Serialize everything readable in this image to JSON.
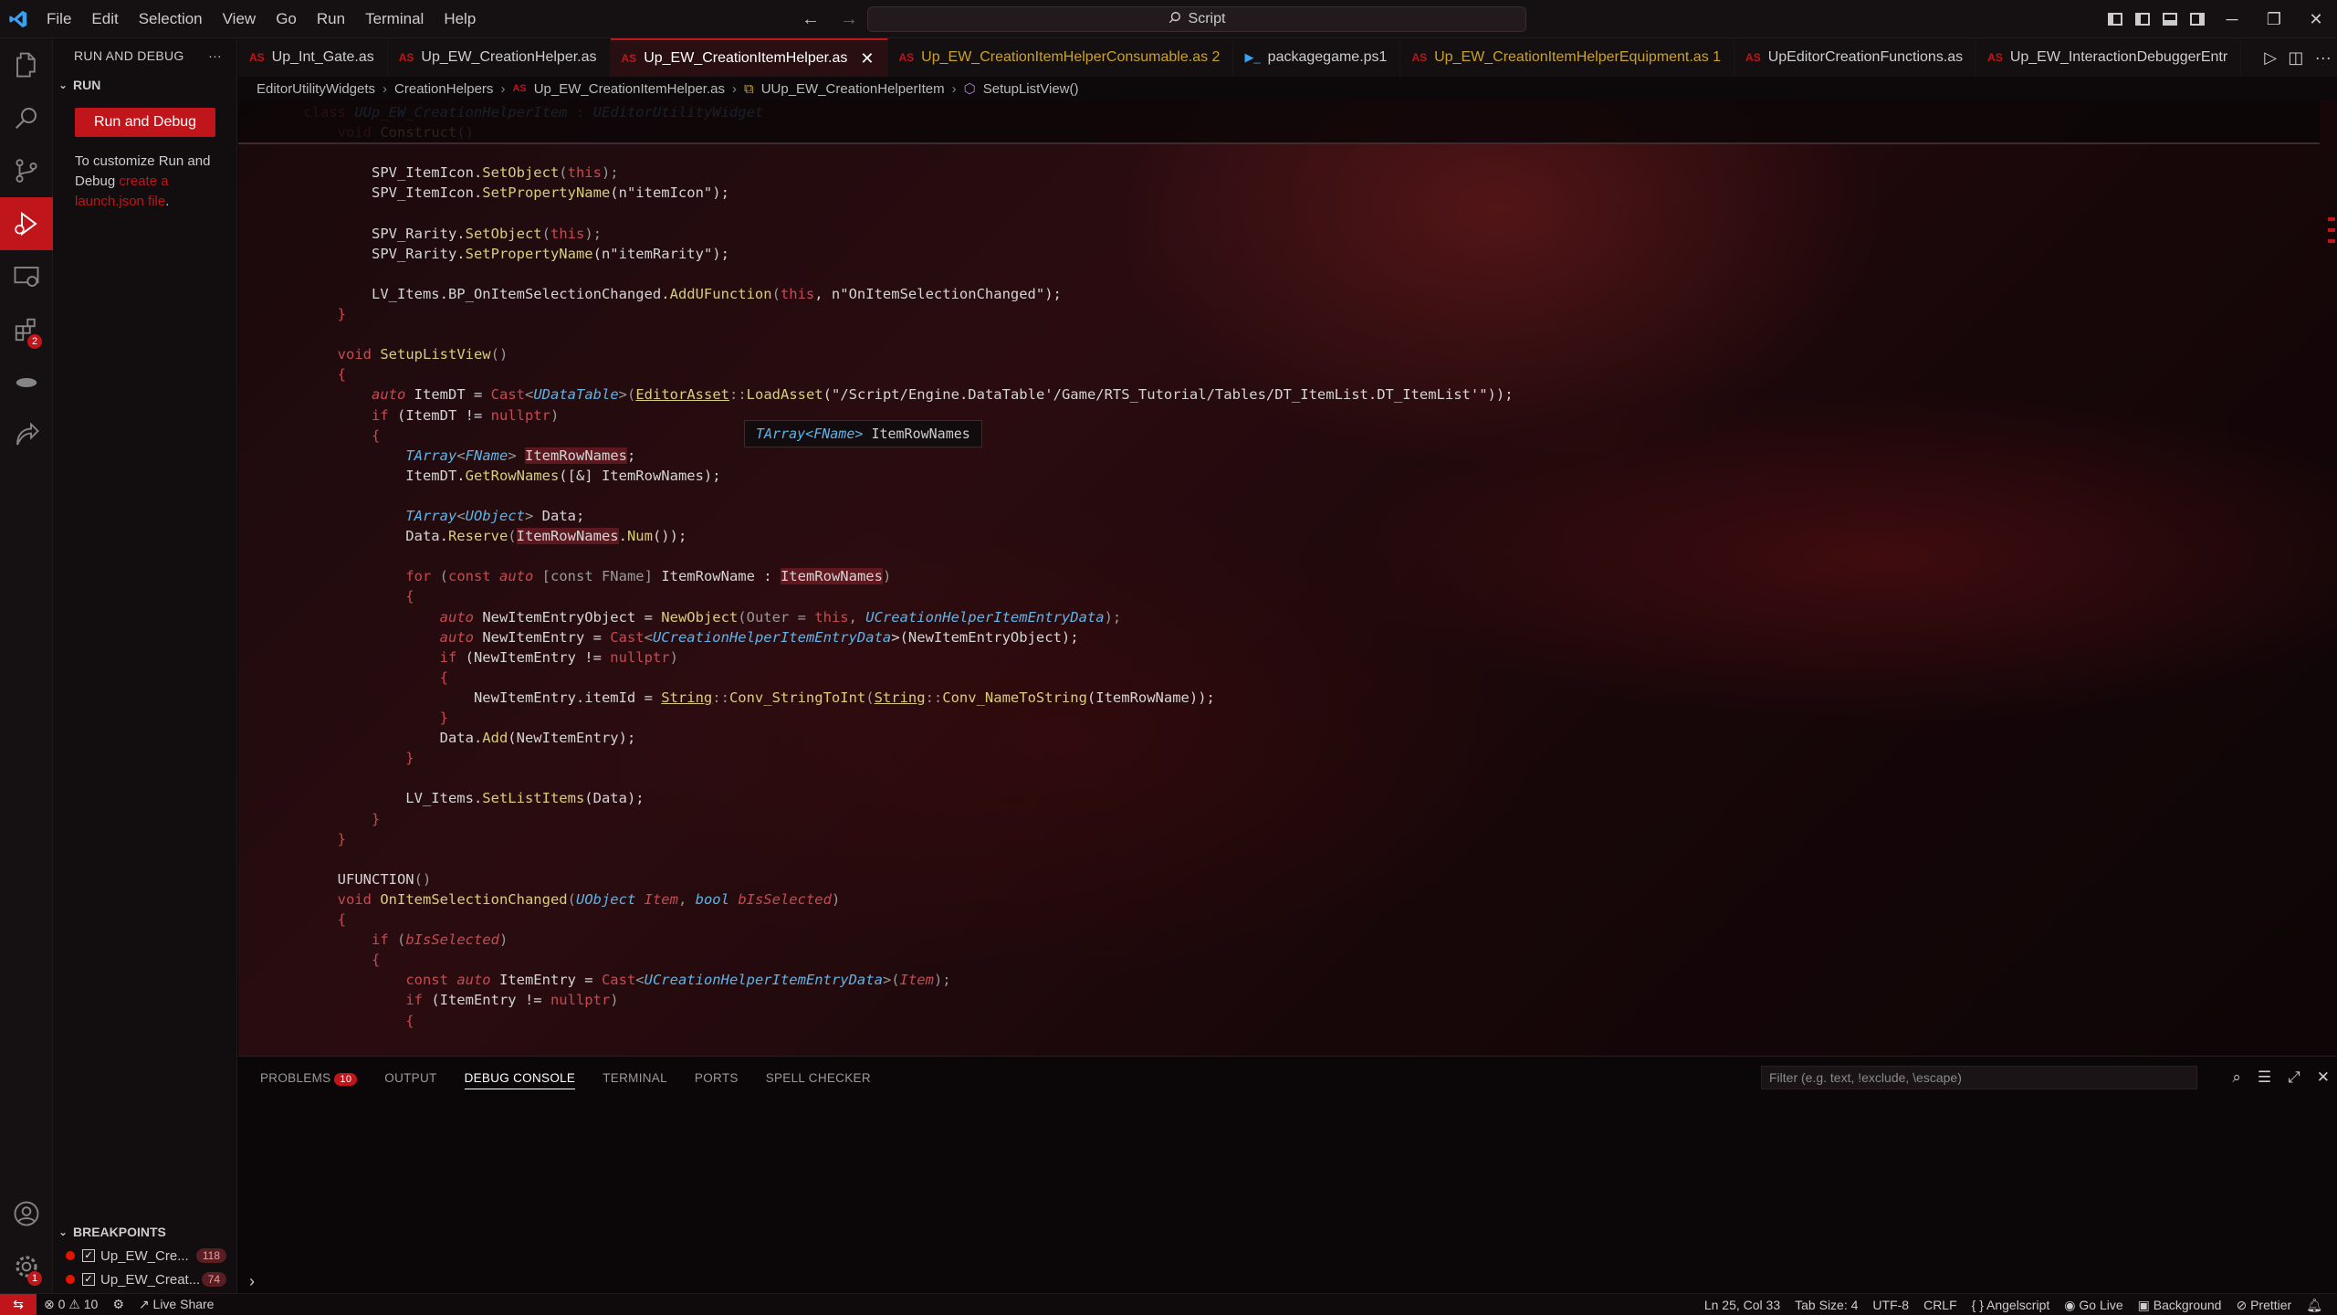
{
  "menu": [
    "File",
    "Edit",
    "Selection",
    "View",
    "Go",
    "Run",
    "Terminal",
    "Help"
  ],
  "command_center": "Script",
  "sidebar": {
    "title": "RUN AND DEBUG",
    "run_section": "RUN",
    "run_button": "Run and Debug",
    "customize_text": "To customize Run and Debug",
    "customize_link": "create a launch.json file",
    "customize_end": ".",
    "breakpoints_title": "BREAKPOINTS",
    "breakpoints": [
      {
        "name": "Up_EW_Cre...",
        "line": "118"
      },
      {
        "name": "Up_EW_Creat...",
        "line": "74"
      }
    ]
  },
  "tabs": [
    {
      "label": "Up_Int_Gate.as",
      "state": "normal"
    },
    {
      "label": "Up_EW_CreationHelper.as",
      "state": "normal"
    },
    {
      "label": "Up_EW_CreationItemHelper.as",
      "state": "active"
    },
    {
      "label": "Up_EW_CreationItemHelperConsumable.as 2",
      "state": "warn"
    },
    {
      "label": "packagegame.ps1",
      "state": "normal"
    },
    {
      "label": "Up_EW_CreationItemHelperEquipment.as 1",
      "state": "warn"
    },
    {
      "label": "UpEditorCreationFunctions.as",
      "state": "normal"
    },
    {
      "label": "Up_EW_InteractionDebuggerEntr",
      "state": "normal"
    }
  ],
  "breadcrumb": [
    "EditorUtilityWidgets",
    "CreationHelpers",
    "Up_EW_CreationItemHelper.as",
    "UUp_EW_CreationHelperItem",
    "SetupListView()"
  ],
  "hover_tip": {
    "type": "TArray<FName>",
    "name": "ItemRowNames"
  },
  "panel": {
    "tabs": [
      "PROBLEMS",
      "OUTPUT",
      "DEBUG CONSOLE",
      "TERMINAL",
      "PORTS",
      "SPELL CHECKER"
    ],
    "problems_count": "10",
    "active_tab": "DEBUG CONSOLE",
    "filter_placeholder": "Filter (e.g. text, !exclude, \\escape)"
  },
  "statusbar": {
    "errors": "0",
    "warnings": "10",
    "live_share": "Live Share",
    "position": "Ln 25, Col 33",
    "tab_size": "Tab Size: 4",
    "encoding": "UTF-8",
    "eol": "CRLF",
    "language": "Angelscript",
    "go_live": "Go Live",
    "background": "Background",
    "prettier": "Prettier"
  },
  "colors": {
    "accent": "#c0151a",
    "keyword": "#c74a52",
    "type": "#5fb3e6",
    "function": "#d9cd7a"
  },
  "code_lines": [
    [
      [
        "    ",
        ""
      ],
      [
        "class ",
        "k"
      ],
      [
        "UUp_EW_CreationHelperItem",
        "t"
      ],
      [
        " : ",
        "p"
      ],
      [
        "UEditorUtilityWidget",
        "t"
      ]
    ],
    [
      [
        "        ",
        ""
      ],
      [
        "void ",
        "k"
      ],
      [
        "Construct",
        "f"
      ],
      [
        "()",
        "p"
      ]
    ],
    [],
    [
      [
        "            SPV_ItemIcon.",
        ""
      ],
      [
        "SetObject",
        "f"
      ],
      [
        "(",
        "p"
      ],
      [
        "this",
        "k"
      ],
      [
        ");",
        "p"
      ]
    ],
    [
      [
        "            SPV_ItemIcon.",
        ""
      ],
      [
        "SetPropertyName",
        "f"
      ],
      [
        "(n\"itemIcon\");",
        ""
      ]
    ],
    [],
    [
      [
        "            SPV_Rarity.",
        ""
      ],
      [
        "SetObject",
        "f"
      ],
      [
        "(",
        "p"
      ],
      [
        "this",
        "k"
      ],
      [
        ");",
        "p"
      ]
    ],
    [
      [
        "            SPV_Rarity.",
        ""
      ],
      [
        "SetPropertyName",
        "f"
      ],
      [
        "(n\"itemRarity\");",
        ""
      ]
    ],
    [],
    [
      [
        "            LV_Items.BP_OnItemSelectionChanged.",
        ""
      ],
      [
        "AddUFunction",
        "f"
      ],
      [
        "(",
        "p"
      ],
      [
        "this",
        "k"
      ],
      [
        ", n\"OnItemSelectionChanged\");",
        ""
      ]
    ],
    [
      [
        "        }",
        "k"
      ]
    ],
    [],
    [
      [
        "        ",
        ""
      ],
      [
        "void ",
        "k"
      ],
      [
        "SetupListView",
        "f"
      ],
      [
        "()",
        "p"
      ]
    ],
    [
      [
        "        {",
        "k"
      ]
    ],
    [
      [
        "            ",
        ""
      ],
      [
        "auto ",
        "ki"
      ],
      [
        "ItemDT = ",
        ""
      ],
      [
        "Cast",
        "k"
      ],
      [
        "<",
        "p"
      ],
      [
        "UDataTable",
        "t"
      ],
      [
        ">(",
        "p"
      ],
      [
        "EditorAsset",
        "fu"
      ],
      [
        "::",
        "p"
      ],
      [
        "LoadAsset",
        "f"
      ],
      [
        "(\"/Script/Engine.DataTable'/Game/RTS_Tutorial/Tables/DT_ItemList.DT_ItemList'\"));",
        ""
      ]
    ],
    [
      [
        "            ",
        ""
      ],
      [
        "if ",
        "k"
      ],
      [
        "(ItemDT != ",
        ""
      ],
      [
        "nullptr",
        "k"
      ],
      [
        ")",
        "p"
      ]
    ],
    [
      [
        "            {",
        "k"
      ]
    ],
    [
      [
        "                ",
        ""
      ],
      [
        "TArray",
        "t"
      ],
      [
        "<",
        "p"
      ],
      [
        "FName",
        "t"
      ],
      [
        "> ",
        "p"
      ],
      [
        "ItemRowNames",
        "hl"
      ],
      [
        ";",
        ""
      ]
    ],
    [
      [
        "                ItemDT.",
        ""
      ],
      [
        "GetRowNames",
        "f"
      ],
      [
        "([&] ItemRowNames);",
        ""
      ]
    ],
    [],
    [
      [
        "                ",
        ""
      ],
      [
        "TArray",
        "t"
      ],
      [
        "<",
        "p"
      ],
      [
        "UObject",
        "t"
      ],
      [
        "> ",
        "p"
      ],
      [
        "Data;",
        ""
      ]
    ],
    [
      [
        "                Data.",
        ""
      ],
      [
        "Reserve",
        "f"
      ],
      [
        "(",
        "p"
      ],
      [
        "ItemRowNames",
        "hl"
      ],
      [
        ".",
        ""
      ],
      [
        "Num",
        "f"
      ],
      [
        "());",
        ""
      ]
    ],
    [],
    [
      [
        "                ",
        ""
      ],
      [
        "for ",
        "k"
      ],
      [
        "(",
        "p"
      ],
      [
        "const ",
        "k"
      ],
      [
        "auto ",
        "ki"
      ],
      [
        "[const FName] ",
        "p"
      ],
      [
        "ItemRowName : ",
        ""
      ],
      [
        "ItemRowNames",
        "hl"
      ],
      [
        ")",
        "p"
      ]
    ],
    [
      [
        "                {",
        "k"
      ]
    ],
    [
      [
        "                    ",
        ""
      ],
      [
        "auto ",
        "ki"
      ],
      [
        "NewItemEntryObject = ",
        ""
      ],
      [
        "NewObject",
        "f"
      ],
      [
        "(Outer = ",
        "p"
      ],
      [
        "this",
        "k"
      ],
      [
        ", ",
        "p"
      ],
      [
        "UCreationHelperItemEntryData",
        "t"
      ],
      [
        ");",
        "p"
      ]
    ],
    [
      [
        "                    ",
        ""
      ],
      [
        "auto ",
        "ki"
      ],
      [
        "NewItemEntry = ",
        ""
      ],
      [
        "Cast",
        "k"
      ],
      [
        "<",
        "p"
      ],
      [
        "UCreationHelperItemEntryData",
        "t"
      ],
      [
        ">(NewItemEntryObject);",
        ""
      ]
    ],
    [
      [
        "                    ",
        ""
      ],
      [
        "if ",
        "k"
      ],
      [
        "(NewItemEntry != ",
        ""
      ],
      [
        "nullptr",
        "k"
      ],
      [
        ")",
        "p"
      ]
    ],
    [
      [
        "                    {",
        "k"
      ]
    ],
    [
      [
        "                        NewItemEntry.itemId = ",
        ""
      ],
      [
        "String",
        "fu"
      ],
      [
        "::",
        "p"
      ],
      [
        "Conv_StringToInt",
        "f"
      ],
      [
        "(",
        "p"
      ],
      [
        "String",
        "fu"
      ],
      [
        "::",
        "p"
      ],
      [
        "Conv_NameToString",
        "f"
      ],
      [
        "(ItemRowName));",
        ""
      ]
    ],
    [
      [
        "                    }",
        "k"
      ]
    ],
    [
      [
        "                    Data.",
        ""
      ],
      [
        "Add",
        "f"
      ],
      [
        "(NewItemEntry);",
        ""
      ]
    ],
    [
      [
        "                }",
        "k"
      ]
    ],
    [],
    [
      [
        "                LV_Items.",
        ""
      ],
      [
        "SetListItems",
        "f"
      ],
      [
        "(Data);",
        ""
      ]
    ],
    [
      [
        "            }",
        "k"
      ]
    ],
    [
      [
        "        }",
        "k"
      ]
    ],
    [],
    [
      [
        "        UFUNCTION",
        ""
      ],
      [
        "()",
        "p"
      ]
    ],
    [
      [
        "        ",
        ""
      ],
      [
        "void ",
        "k"
      ],
      [
        "OnItemSelectionChanged",
        "f"
      ],
      [
        "(",
        "p"
      ],
      [
        "UObject ",
        "t"
      ],
      [
        "Item",
        "ki"
      ],
      [
        ", ",
        "p"
      ],
      [
        "bool ",
        "t"
      ],
      [
        "bIsSelected",
        "ki"
      ],
      [
        ")",
        "p"
      ]
    ],
    [
      [
        "        {",
        "k"
      ]
    ],
    [
      [
        "            ",
        ""
      ],
      [
        "if ",
        "k"
      ],
      [
        "(",
        "p"
      ],
      [
        "bIsSelected",
        "ki"
      ],
      [
        ")",
        "p"
      ]
    ],
    [
      [
        "            {",
        "k"
      ]
    ],
    [
      [
        "                ",
        ""
      ],
      [
        "const ",
        "k"
      ],
      [
        "auto ",
        "ki"
      ],
      [
        "ItemEntry = ",
        ""
      ],
      [
        "Cast",
        "k"
      ],
      [
        "<",
        "p"
      ],
      [
        "UCreationHelperItemEntryData",
        "t"
      ],
      [
        ">(",
        "p"
      ],
      [
        "Item",
        "ki"
      ],
      [
        ");",
        "p"
      ]
    ],
    [
      [
        "                ",
        ""
      ],
      [
        "if ",
        "k"
      ],
      [
        "(ItemEntry != ",
        ""
      ],
      [
        "nullptr",
        "k"
      ],
      [
        ")",
        "p"
      ]
    ],
    [
      [
        "                {",
        "k"
      ]
    ]
  ]
}
